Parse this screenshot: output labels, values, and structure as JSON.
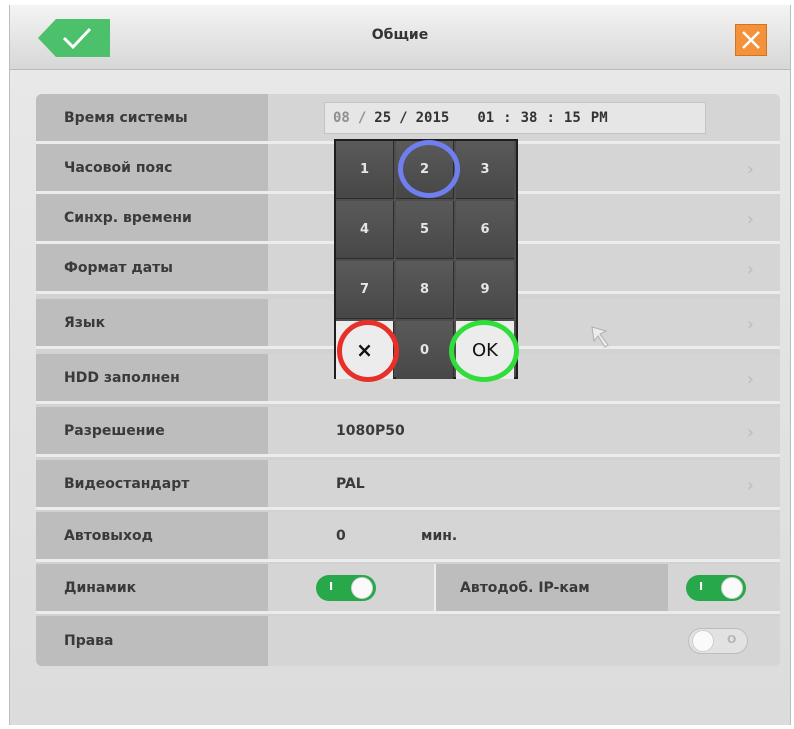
{
  "window": {
    "title": "Общие",
    "back_icon": "checkmark-icon",
    "close_icon": "close-icon",
    "colors": {
      "confirm": "#4cc06a",
      "close": "#f3923a",
      "toggle_on": "#27a84a"
    }
  },
  "settings": {
    "system_time": {
      "label": "Время системы",
      "month": "08",
      "day": "25",
      "year": "2015",
      "hour": "01",
      "minute": "38",
      "second": "15",
      "ampm": "PM",
      "sep_date": "/",
      "sep_time": ":"
    },
    "timezone": {
      "label": "Часовой пояс"
    },
    "time_sync": {
      "label": "Синхр. времени"
    },
    "date_format": {
      "label": "Формат даты"
    },
    "language": {
      "label": "Язык"
    },
    "hdd_full": {
      "label": "HDD заполнен"
    },
    "resolution": {
      "label": "Разрешение",
      "value": "1080P50"
    },
    "video_standard": {
      "label": "Видеостандарт",
      "value": "PAL"
    },
    "auto_exit": {
      "label": "Автовыход",
      "value": "0",
      "unit": "мин."
    },
    "speaker": {
      "label": "Динамик",
      "state": "on",
      "mark": "I"
    },
    "auto_add_ip": {
      "label": "Автодоб. IP-кам",
      "state": "on",
      "mark": "I"
    },
    "rights": {
      "label": "Права",
      "state": "off",
      "mark": "O"
    }
  },
  "numpad": {
    "keys": [
      "1",
      "2",
      "3",
      "4",
      "5",
      "6",
      "7",
      "8",
      "9"
    ],
    "clear": "×",
    "zero": "0",
    "ok": "OK",
    "highlight_colors": {
      "blue": "#6f7ff0",
      "red": "#e8302a",
      "green": "#30dd3a"
    }
  },
  "chevron": "›"
}
